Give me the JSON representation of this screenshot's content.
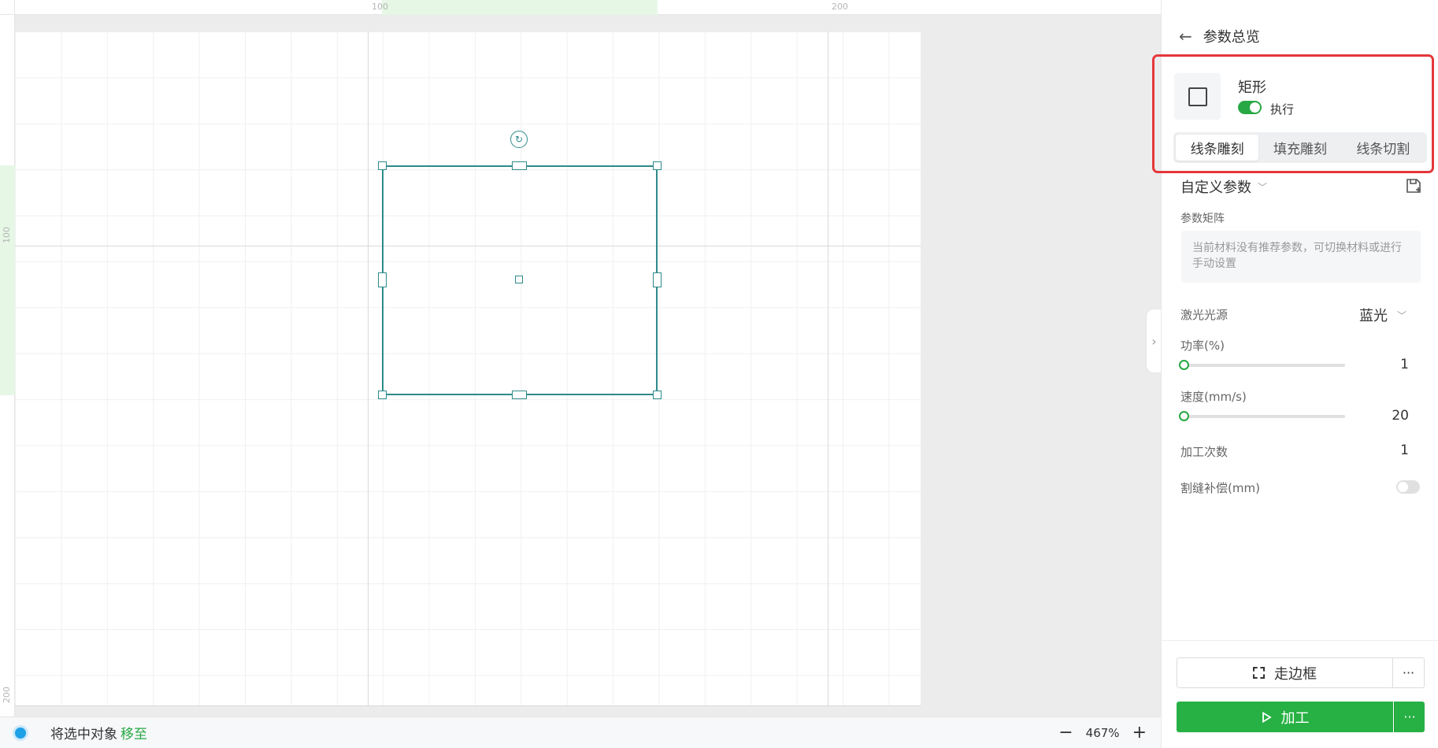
{
  "canvas": {
    "ruler_top_labels": [
      "100",
      "200"
    ],
    "ruler_left_labels": [
      "100",
      "200"
    ]
  },
  "bottom_bar": {
    "move_text": "将选中对象",
    "move_link": "移至",
    "zoom_out": "−",
    "zoom_level": "467%",
    "zoom_in": "+"
  },
  "panel": {
    "back_icon": "←",
    "title": "参数总览",
    "shape": {
      "name": "矩形",
      "exec_label": "执行",
      "exec_on": true
    },
    "tabs": [
      {
        "label": "线条雕刻",
        "active": true
      },
      {
        "label": "填充雕刻",
        "active": false
      },
      {
        "label": "线条切割",
        "active": false
      }
    ],
    "custom_param": "自定义参数",
    "matrix_label": "参数矩阵",
    "matrix_text": "当前材料没有推荐参数，可切换材料或进行手动设置",
    "laser_label": "激光光源",
    "laser_value": "蓝光",
    "power_label": "功率(%)",
    "power_value": "1",
    "speed_label": "速度(mm/s)",
    "speed_value": "20",
    "passes_label": "加工次数",
    "passes_value": "1",
    "kerf_label": "割缝补偿(mm)",
    "kerf_on": false,
    "frame_button": "走边框",
    "process_button": "加工",
    "more": "···"
  },
  "colors": {
    "accent_green": "#27b144",
    "selection_teal": "#2e8a8a",
    "highlight_red": "#e5383b"
  }
}
